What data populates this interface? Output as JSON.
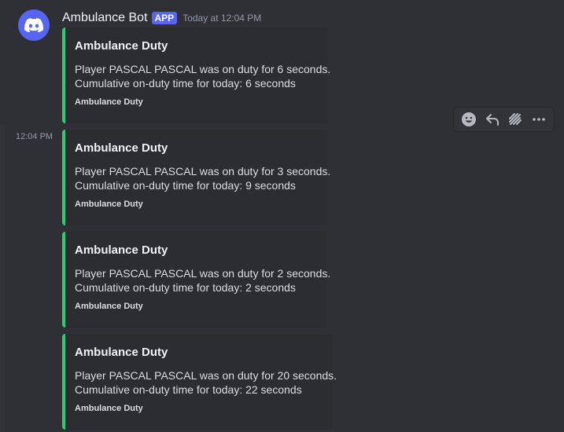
{
  "message": {
    "username": "Ambulance Bot",
    "badge": "APP",
    "timestamp": "Today at 12:04 PM",
    "side_timestamp": "12:04 PM"
  },
  "embeds": [
    {
      "title": "Ambulance Duty",
      "line1": "Player PASCAL PASCAL was on duty for 6 seconds.",
      "line2": "Cumulative on-duty time for today: 6 seconds",
      "footer": "Ambulance Duty"
    },
    {
      "title": "Ambulance Duty",
      "line1": "Player PASCAL PASCAL was on duty for 3 seconds.",
      "line2": "Cumulative on-duty time for today: 9 seconds",
      "footer": "Ambulance Duty"
    },
    {
      "title": "Ambulance Duty",
      "line1": "Player PASCAL PASCAL was on duty for 2 seconds.",
      "line2": "Cumulative on-duty time for today: 2 seconds",
      "footer": "Ambulance Duty"
    },
    {
      "title": "Ambulance Duty",
      "line1": "Player PASCAL PASCAL was on duty for 20 seconds.",
      "line2": "Cumulative on-duty time for today: 22 seconds",
      "footer": "Ambulance Duty"
    }
  ],
  "toolbar": {
    "icons": [
      "emoji-icon",
      "reply-icon",
      "thread-icon",
      "more-icon"
    ]
  },
  "colors": {
    "background": "#313338",
    "embed_background": "#2b2d31",
    "embed_accent": "#2ecc71",
    "brand": "#5865f2"
  }
}
